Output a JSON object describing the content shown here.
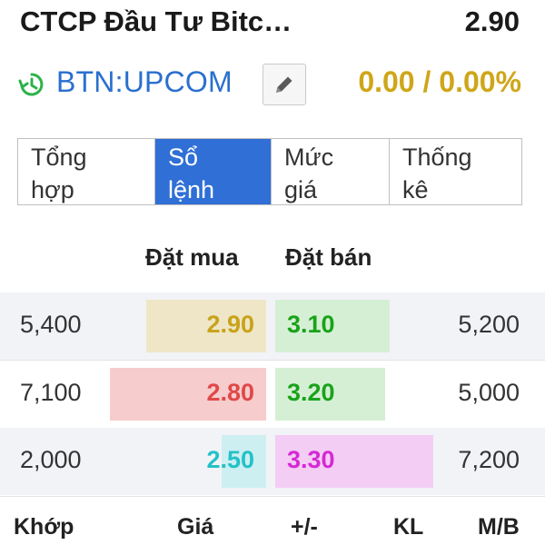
{
  "header": {
    "name": "CTCP Đầu Tư Bitc…",
    "price": "2.90",
    "symbol": "BTN:UPCOM",
    "change": "0.00 / 0.00%",
    "change_color": "#cfa61a"
  },
  "icons": {
    "clock": "clock-refresh-icon",
    "edit": "pencil-icon"
  },
  "tabs": [
    {
      "line1": "Tổng",
      "line2": "hợp"
    },
    {
      "line1": "Sổ",
      "line2": "lệnh"
    },
    {
      "line1": "Mức",
      "line2": "giá"
    },
    {
      "line1": "Thống",
      "line2": "kê"
    }
  ],
  "active_tab": "Sổ lệnh",
  "order_book": {
    "buy_header": "Đặt mua",
    "sell_header": "Đặt bán",
    "rows": [
      {
        "buy_volume": "5,400",
        "buy_price": "2.90",
        "sell_price": "3.10",
        "sell_volume": "5,200",
        "buy_color": "#c9a21a",
        "buy_bar_color": "#eee6c6",
        "sell_color": "#19a319",
        "sell_bar_color": "#d5efd5"
      },
      {
        "buy_volume": "7,100",
        "buy_price": "2.80",
        "sell_price": "3.20",
        "sell_volume": "5,000",
        "buy_color": "#e04848",
        "buy_bar_color": "#f6cccc",
        "sell_color": "#19a319",
        "sell_bar_color": "#d5efd5"
      },
      {
        "buy_volume": "2,000",
        "buy_price": "2.50",
        "sell_price": "3.30",
        "sell_volume": "7,200",
        "buy_color": "#22c2c8",
        "buy_bar_color": "#cdeff1",
        "sell_color": "#d628d6",
        "sell_bar_color": "#f3cdf3"
      }
    ]
  },
  "footer": {
    "match": "Khớp",
    "price": "Giá",
    "change": "+/-",
    "volume": "KL",
    "side": "M/B"
  }
}
